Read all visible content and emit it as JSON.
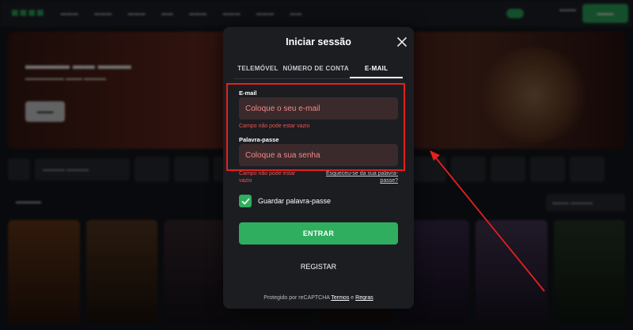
{
  "modal": {
    "title": "Iniciar sessão",
    "tabs": [
      {
        "label": "TELEMÓVEL",
        "active": false
      },
      {
        "label": "NÚMERO DE CONTA",
        "active": false
      },
      {
        "label": "E-MAIL",
        "active": true
      }
    ],
    "email": {
      "label": "E-mail",
      "placeholder": "Coloque o seu e-mail",
      "error": "Campo não pode estar vazio"
    },
    "password": {
      "label": "Palavra-passe",
      "placeholder": "Coloque a sua senha",
      "error": "Campo não pode estar vazio",
      "forgot_link": "Esqueceu-se da sua palavra-passe?"
    },
    "remember": {
      "label": "Guardar palavra-passe",
      "checked": true
    },
    "submit_label": "ENTRAR",
    "register_label": "REGISTAR",
    "captcha": {
      "prefix": "Protegido por reCAPTCHA",
      "terms": "Termos",
      "and": "e",
      "rules": "Regras"
    }
  },
  "colors": {
    "accent_green": "#2fae5f",
    "error_red": "#ef5350",
    "annotation_red": "#e52020",
    "modal_bg": "#1b1d21",
    "field_bg": "#3a2a2c"
  },
  "icons": {
    "close": "close-icon",
    "checkbox": "check-icon"
  }
}
